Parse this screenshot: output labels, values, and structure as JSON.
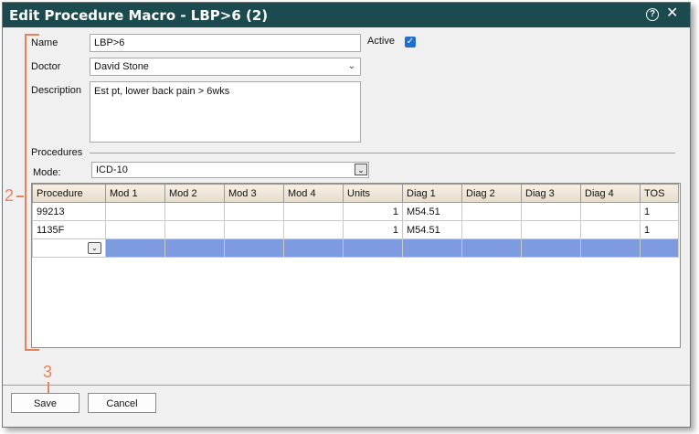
{
  "window": {
    "title": "Edit Procedure Macro - LBP>6 (2)"
  },
  "form": {
    "name_label": "Name",
    "name_value": "LBP>6",
    "active_label": "Active",
    "active_checked": true,
    "doctor_label": "Doctor",
    "doctor_value": "David Stone",
    "description_label": "Description",
    "description_value": "Est pt, lower back pain > 6wks"
  },
  "procedures": {
    "section_label": "Procedures",
    "mode_label": "Mode:",
    "mode_value": "ICD-10",
    "columns": [
      "Procedure",
      "Mod 1",
      "Mod 2",
      "Mod 3",
      "Mod 4",
      "Units",
      "Diag 1",
      "Diag 2",
      "Diag 3",
      "Diag 4",
      "TOS"
    ],
    "rows": [
      [
        "99213",
        "",
        "",
        "",
        "",
        "1",
        "M54.51",
        "",
        "",
        "",
        "1"
      ],
      [
        "1135F",
        "",
        "",
        "",
        "",
        "1",
        "M54.51",
        "",
        "",
        "",
        "1"
      ]
    ]
  },
  "callouts": {
    "two": "2",
    "three": "3"
  },
  "footer": {
    "save_label": "Save",
    "cancel_label": "Cancel"
  },
  "colors": {
    "titlebar": "#1b4b4e",
    "callout": "#e8825a",
    "selected_row": "#7f9be0",
    "checkbox": "#1f6fd0"
  }
}
